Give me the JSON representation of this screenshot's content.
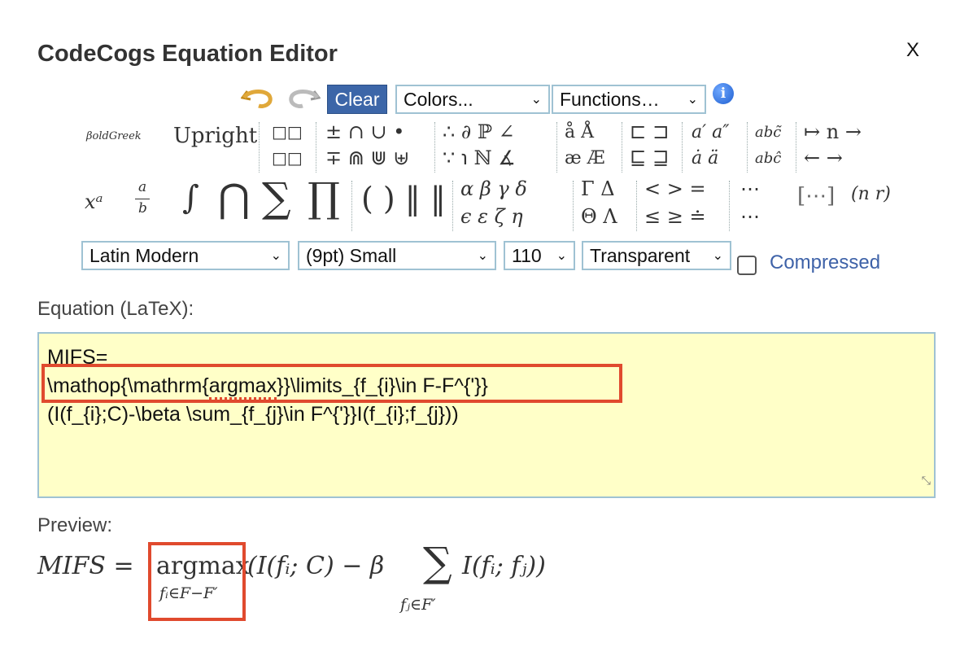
{
  "dialog": {
    "title": "CodeCogs Equation Editor",
    "close_label": "X"
  },
  "toolbar": {
    "clear_label": "Clear",
    "colors_value": "Colors...",
    "functions_value": "Functions…",
    "info_label": "i"
  },
  "symbols": {
    "style_bold_greek": "βoldGreek",
    "style_upright": "Upright",
    "matrix_top": "□□",
    "matrix_bottom": "□□",
    "ops_top": "± ∩ ∪ •",
    "ops_bottom": "∓ ⋒ ⋓ ⊎",
    "logic_top": "∴ ∂ ℙ ∠",
    "logic_bottom": "∵ ℩ ℕ ∡",
    "accent_top": "å Å",
    "accent_bottom": "æ Æ",
    "sets_top": "⊏ ⊐",
    "sets_bottom": "⊑ ⊒",
    "prime_top": "a′ a″",
    "prime_bottom": "ȧ ä",
    "wide_top": "abc̃",
    "wide_bottom": "abĉ",
    "arrows_top": "↦ n →",
    "arrows_bottom": "← →",
    "superscript": "xᵃ",
    "fraction_num": "a",
    "fraction_den": "b",
    "integral": "∫",
    "bigcap": "⋂",
    "sum": "∑",
    "prod": "∏",
    "brackets": "( ) ‖ ‖",
    "greek_top": "α β γ δ",
    "greek_bottom": "ϵ ε ζ η",
    "capgreek_top": "Γ Δ",
    "capgreek_bottom": "Θ Λ",
    "rel_top": "< > =",
    "rel_bottom": "≤ ≥ ≐",
    "dots_top": "⋯",
    "dots_bottom": "⋯",
    "matrix_brackets": "[⋯]",
    "binom": "(n r)"
  },
  "format": {
    "font_value": "Latin Modern",
    "size_value": "(9pt) Small",
    "dpi_value": "110",
    "background_value": "Transparent",
    "compressed_label": "Compressed",
    "compressed_checked": false
  },
  "equation": {
    "label": "Equation (LaTeX):",
    "line1": "MIFS=",
    "line2_prefix": "\\mathop{\\mathrm{",
    "line2_word": "argmax",
    "line2_suffix": "}}\\limits_{f_{i}\\in F-F^{'}}",
    "line3": "(I(f_{i};C)-\\beta \\sum_{f_{j}\\in F^{'}}I(f_{i};f_{j}))"
  },
  "preview": {
    "label": "Preview:",
    "lhs": "MIFS =",
    "operator": "argmax",
    "operator_sub": "fᵢ∈F−F′",
    "body1": "(I(fᵢ; C) − β",
    "sum": "∑",
    "sum_sub": "fⱼ∈F′",
    "body2": "I(fᵢ; fⱼ))"
  },
  "colors": {
    "clear_bg": "#3c66a8",
    "select_border": "#9fc2d3",
    "equation_bg": "#ffffc8",
    "highlight": "#e04a2e",
    "link": "#3e62a8"
  }
}
